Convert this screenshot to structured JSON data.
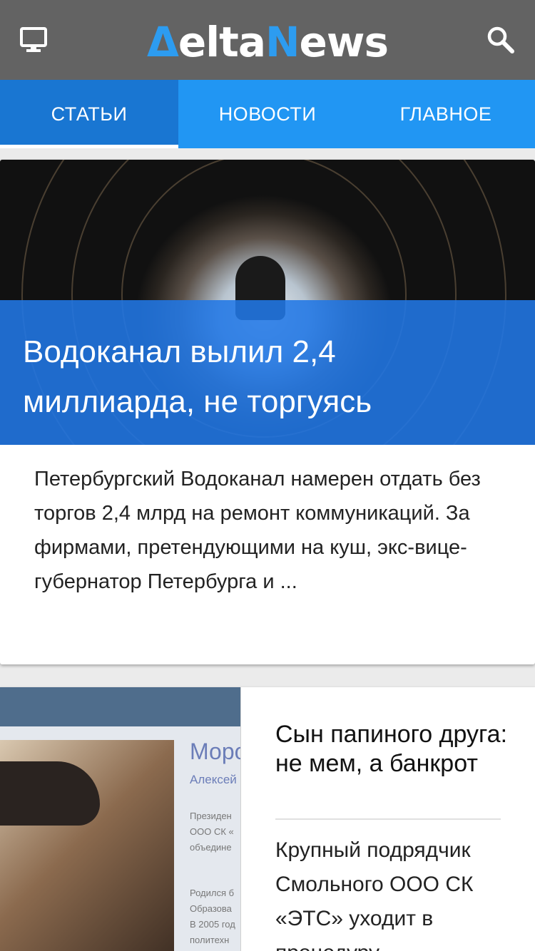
{
  "header": {
    "logo_delta": "Δ",
    "logo_elta": "elta",
    "logo_n": "N",
    "logo_ews": "ews",
    "left_icon": "desktop-icon",
    "right_icon": "search-icon"
  },
  "tabs": [
    {
      "label": "СТАТЬИ",
      "active": true
    },
    {
      "label": "НОВОСТИ",
      "active": false
    },
    {
      "label": "ГЛАВНОЕ",
      "active": false
    }
  ],
  "featured": {
    "title": "Водоканал вылил 2,4 миллиарда, не торгуясь",
    "excerpt": "Петербургский Водоканал намерен отдать без торгов 2,4 млрд на ремонт коммуникаций. За фирмами, претендующими на куш, экс-вице-губернатор Петербурга и ..."
  },
  "second": {
    "title": "Сын папиного друга: не мем, а банкрот",
    "excerpt": "Крупный подрядчик Смольного ООО СК «ЭТС» уходит в процедуру",
    "thumb": {
      "name": "Моро",
      "person": "Алексей",
      "line1": "Президен",
      "line2": "ООО СК «",
      "line3": "объедине",
      "line4": "Родился б",
      "line5": "Образова",
      "line6": "В 2005 год",
      "line7": "политехн"
    }
  },
  "colors": {
    "topbar": "#636363",
    "tabs": "#2196f3",
    "tab_active": "#1976d2",
    "caption_overlay": "#2178e6",
    "logo_accent": "#2d9cf0"
  }
}
